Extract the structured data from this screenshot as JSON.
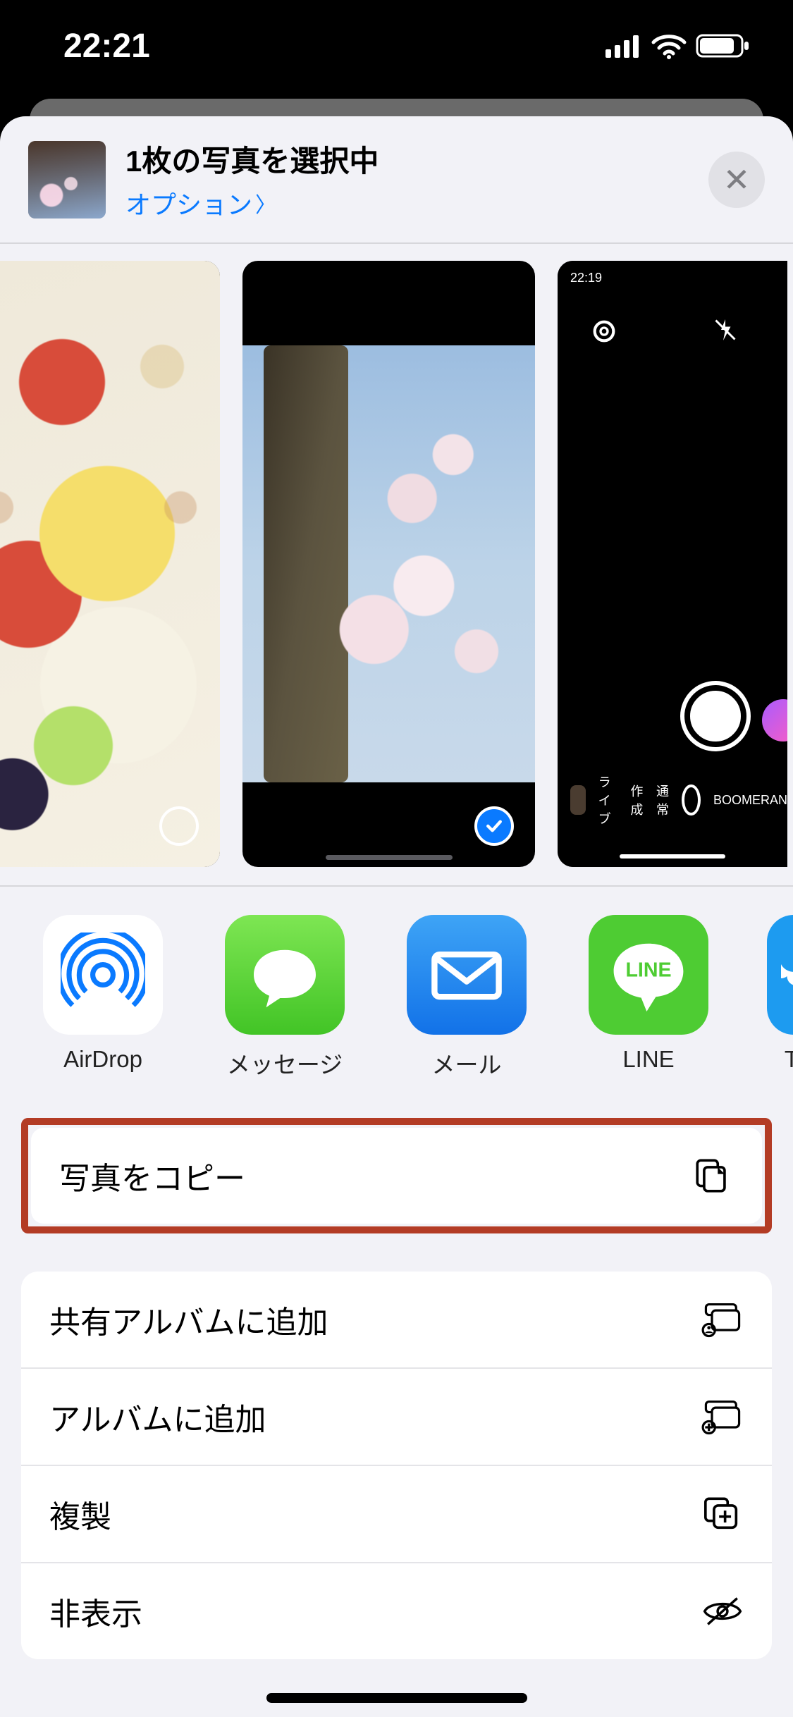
{
  "status": {
    "time": "22:21"
  },
  "header": {
    "title": "1枚の写真を選択中",
    "options_label": "オプション"
  },
  "thumbnails": [
    {
      "selected": false,
      "kind": "food"
    },
    {
      "selected": true,
      "kind": "sakura"
    },
    {
      "selected": false,
      "kind": "camera_ui",
      "overlay": {
        "time": "22:19",
        "modes": [
          "ライブ",
          "作成",
          "通常",
          "BOOMERAN"
        ]
      }
    }
  ],
  "apps": [
    {
      "name": "AirDrop",
      "icon": "airdrop"
    },
    {
      "name": "メッセージ",
      "icon": "messages"
    },
    {
      "name": "メール",
      "icon": "mail"
    },
    {
      "name": "LINE",
      "icon": "line"
    },
    {
      "name": "T",
      "icon": "twitter"
    }
  ],
  "actions_highlight": {
    "label": "写真をコピー",
    "icon": "copy"
  },
  "actions_group": [
    {
      "label": "共有アルバムに追加",
      "icon": "shared-album"
    },
    {
      "label": "アルバムに追加",
      "icon": "add-album"
    },
    {
      "label": "複製",
      "icon": "duplicate"
    },
    {
      "label": "非表示",
      "icon": "hide"
    }
  ]
}
